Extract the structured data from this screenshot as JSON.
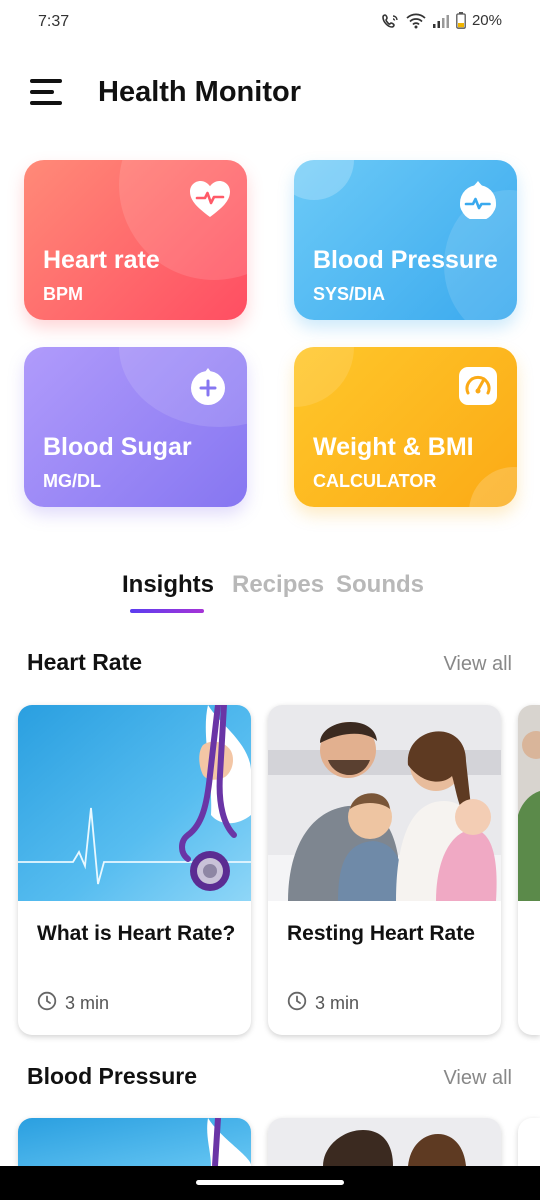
{
  "status": {
    "time": "7:37",
    "battery": "20%"
  },
  "header": {
    "title": "Health Monitor"
  },
  "tiles": [
    {
      "title": "Heart rate",
      "subtitle": "BPM",
      "icon": "heart-pulse-icon"
    },
    {
      "title": "Blood Pressure",
      "subtitle": "SYS/DIA",
      "icon": "blood-drop-pulse-icon"
    },
    {
      "title": "Blood Sugar",
      "subtitle": "MG/DL",
      "icon": "blood-drop-plus-icon"
    },
    {
      "title": "Weight & BMI",
      "subtitle": "CALCULATOR",
      "icon": "gauge-icon"
    }
  ],
  "tabs": [
    {
      "label": "Insights",
      "active": true
    },
    {
      "label": "Recipes",
      "active": false
    },
    {
      "label": "Sounds",
      "active": false
    }
  ],
  "sections": [
    {
      "title": "Heart Rate",
      "view_all": "View all",
      "cards": [
        {
          "title": "What is Heart Rate?",
          "duration": "3 min"
        },
        {
          "title": "Resting Heart Rate",
          "duration": "3 min"
        }
      ]
    },
    {
      "title": "Blood Pressure",
      "view_all": "View all"
    }
  ],
  "colors": {
    "heart_tile": "#ff5a68",
    "pressure_tile": "#45b1f0",
    "sugar_tile": "#9585f5",
    "weight_tile": "#fdb81e",
    "tab_accent": "#7a38e4"
  }
}
